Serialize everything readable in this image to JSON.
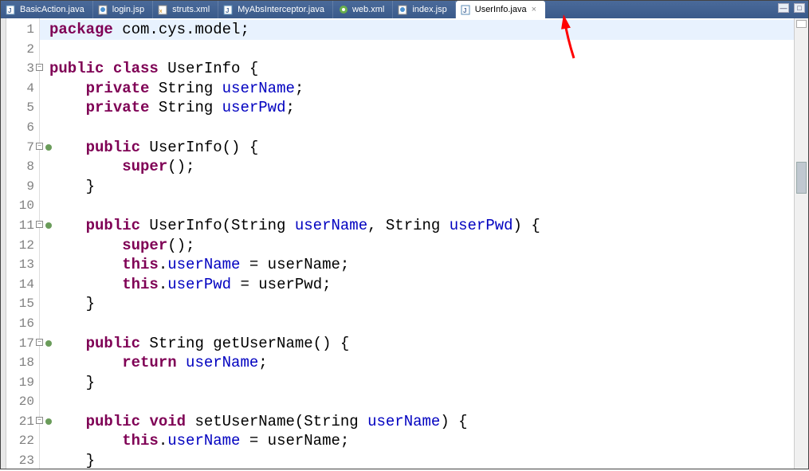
{
  "tabs": [
    {
      "label": "BasicAction.java",
      "icon": "java-file-icon",
      "active": false
    },
    {
      "label": "login.jsp",
      "icon": "jsp-file-icon",
      "active": false
    },
    {
      "label": "struts.xml",
      "icon": "xml-file-icon",
      "active": false
    },
    {
      "label": "MyAbsInterceptor.java",
      "icon": "java-file-icon",
      "active": false
    },
    {
      "label": "web.xml",
      "icon": "webxml-file-icon",
      "active": false
    },
    {
      "label": "index.jsp",
      "icon": "jsp-file-icon",
      "active": false
    },
    {
      "label": "UserInfo.java",
      "icon": "java-file-icon",
      "active": true
    }
  ],
  "gutter": {
    "numbers": [
      "1",
      "2",
      "3",
      "4",
      "5",
      "6",
      "7",
      "8",
      "9",
      "10",
      "11",
      "12",
      "13",
      "14",
      "15",
      "16",
      "17",
      "18",
      "19",
      "20",
      "21",
      "22",
      "23"
    ],
    "fold": {
      "3": "minus",
      "7": "minus",
      "11": "minus",
      "17": "minus",
      "21": "minus"
    },
    "override": {
      "7": true,
      "11": true,
      "17": true,
      "21": true
    }
  },
  "code": {
    "l1": [
      [
        "kw",
        "package"
      ],
      [
        "plain",
        " com.cys.model;"
      ]
    ],
    "l2": [
      [
        "plain",
        ""
      ]
    ],
    "l3": [
      [
        "kw",
        "public"
      ],
      [
        "plain",
        " "
      ],
      [
        "kw",
        "class"
      ],
      [
        "plain",
        " UserInfo {"
      ]
    ],
    "l4": [
      [
        "plain",
        "    "
      ],
      [
        "kw",
        "private"
      ],
      [
        "plain",
        " String "
      ],
      [
        "field",
        "userName"
      ],
      [
        "plain",
        ";"
      ]
    ],
    "l5": [
      [
        "plain",
        "    "
      ],
      [
        "kw",
        "private"
      ],
      [
        "plain",
        " String "
      ],
      [
        "field",
        "userPwd"
      ],
      [
        "plain",
        ";"
      ]
    ],
    "l6": [
      [
        "plain",
        ""
      ]
    ],
    "l7": [
      [
        "plain",
        "    "
      ],
      [
        "kw",
        "public"
      ],
      [
        "plain",
        " UserInfo() {"
      ]
    ],
    "l8": [
      [
        "plain",
        "        "
      ],
      [
        "kw",
        "super"
      ],
      [
        "plain",
        "();"
      ]
    ],
    "l9": [
      [
        "plain",
        "    }"
      ]
    ],
    "l10": [
      [
        "plain",
        ""
      ]
    ],
    "l11": [
      [
        "plain",
        "    "
      ],
      [
        "kw",
        "public"
      ],
      [
        "plain",
        " UserInfo(String "
      ],
      [
        "field",
        "userName"
      ],
      [
        "plain",
        ", String "
      ],
      [
        "field",
        "userPwd"
      ],
      [
        "plain",
        ") {"
      ]
    ],
    "l12": [
      [
        "plain",
        "        "
      ],
      [
        "kw",
        "super"
      ],
      [
        "plain",
        "();"
      ]
    ],
    "l13": [
      [
        "plain",
        "        "
      ],
      [
        "kw",
        "this"
      ],
      [
        "plain",
        "."
      ],
      [
        "field",
        "userName"
      ],
      [
        "plain",
        " = "
      ],
      [
        "plain",
        "userName;"
      ]
    ],
    "l14": [
      [
        "plain",
        "        "
      ],
      [
        "kw",
        "this"
      ],
      [
        "plain",
        "."
      ],
      [
        "field",
        "userPwd"
      ],
      [
        "plain",
        " = "
      ],
      [
        "plain",
        "userPwd;"
      ]
    ],
    "l15": [
      [
        "plain",
        "    }"
      ]
    ],
    "l16": [
      [
        "plain",
        ""
      ]
    ],
    "l17": [
      [
        "plain",
        "    "
      ],
      [
        "kw",
        "public"
      ],
      [
        "plain",
        " String getUserName() {"
      ]
    ],
    "l18": [
      [
        "plain",
        "        "
      ],
      [
        "kw",
        "return"
      ],
      [
        "plain",
        " "
      ],
      [
        "field",
        "userName"
      ],
      [
        "plain",
        ";"
      ]
    ],
    "l19": [
      [
        "plain",
        "    }"
      ]
    ],
    "l20": [
      [
        "plain",
        ""
      ]
    ],
    "l21": [
      [
        "plain",
        "    "
      ],
      [
        "kw",
        "public"
      ],
      [
        "plain",
        " "
      ],
      [
        "kw",
        "void"
      ],
      [
        "plain",
        " setUserName(String "
      ],
      [
        "field",
        "userName"
      ],
      [
        "plain",
        ") {"
      ]
    ],
    "l22": [
      [
        "plain",
        "        "
      ],
      [
        "kw",
        "this"
      ],
      [
        "plain",
        "."
      ],
      [
        "field",
        "userName"
      ],
      [
        "plain",
        " = "
      ],
      [
        "plain",
        "userName;"
      ]
    ],
    "l23": [
      [
        "plain",
        "    }"
      ]
    ]
  },
  "highlight_line": 1,
  "annotation": {
    "type": "arrow",
    "color": "#ff0000"
  }
}
